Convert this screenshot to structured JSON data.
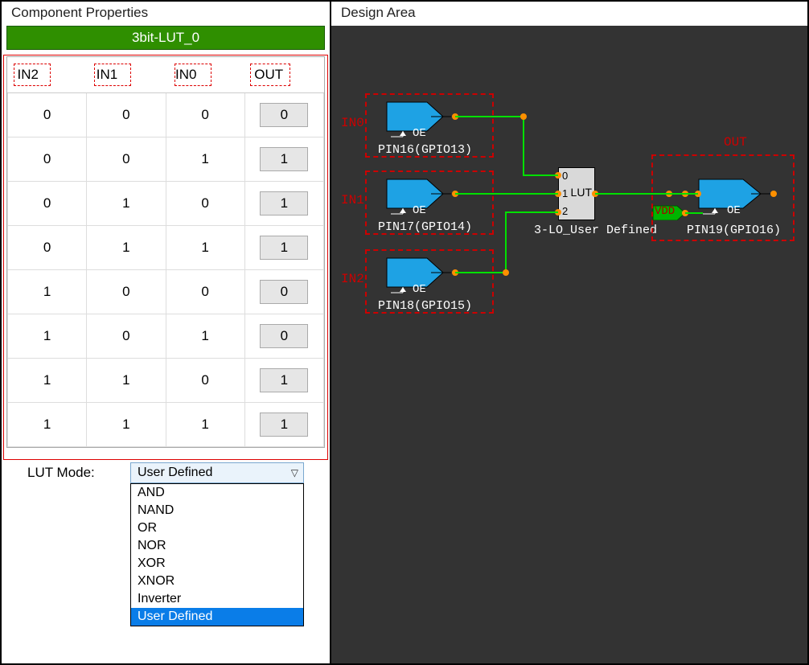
{
  "panels": {
    "properties_title": "Component Properties",
    "design_title": "Design Area",
    "component_name": "3bit-LUT_0"
  },
  "table": {
    "headers": {
      "in2": "IN2",
      "in1": "IN1",
      "in0": "IN0",
      "out": "OUT"
    },
    "rows": [
      {
        "in2": "0",
        "in1": "0",
        "in0": "0",
        "out": "0"
      },
      {
        "in2": "0",
        "in1": "0",
        "in0": "1",
        "out": "1"
      },
      {
        "in2": "0",
        "in1": "1",
        "in0": "0",
        "out": "1"
      },
      {
        "in2": "0",
        "in1": "1",
        "in0": "1",
        "out": "1"
      },
      {
        "in2": "1",
        "in1": "0",
        "in0": "0",
        "out": "0"
      },
      {
        "in2": "1",
        "in1": "0",
        "in0": "1",
        "out": "0"
      },
      {
        "in2": "1",
        "in1": "1",
        "in0": "0",
        "out": "1"
      },
      {
        "in2": "1",
        "in1": "1",
        "in0": "1",
        "out": "1"
      }
    ]
  },
  "lut_mode": {
    "label": "LUT Mode:",
    "selected": "User Defined",
    "options": [
      "AND",
      "NAND",
      "OR",
      "NOR",
      "XOR",
      "XNOR",
      "Inverter",
      "User Defined"
    ]
  },
  "design": {
    "annotations": {
      "in0": "IN0",
      "in1": "IN1",
      "in2": "IN2",
      "out": "OUT"
    },
    "pins": {
      "pin16": "PIN16(GPIO13)",
      "pin17": "PIN17(GPIO14)",
      "pin18": "PIN18(GPIO15)",
      "pin19": "PIN19(GPIO16)"
    },
    "lut_label": "LUT",
    "lut_name": "3-LO_User Defined",
    "vdd": "VDD",
    "oe": "OE"
  }
}
